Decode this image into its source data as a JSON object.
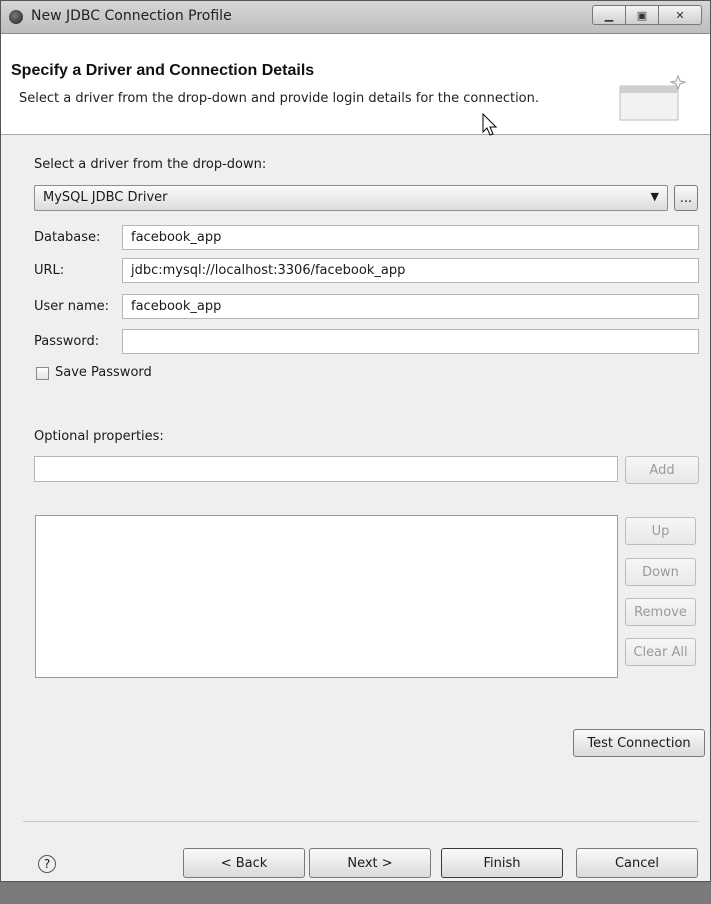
{
  "window": {
    "title": "New JDBC Connection Profile"
  },
  "banner": {
    "title": "Specify a Driver and Connection Details",
    "description": "Select a driver from the drop-down and provide login details for the connection."
  },
  "driver": {
    "label": "Select a driver from the drop-down:",
    "selected": "MySQL JDBC Driver",
    "browse_label": "..."
  },
  "fields": {
    "database": {
      "label": "Database:",
      "value": "facebook_app"
    },
    "url": {
      "label": "URL:",
      "value": "jdbc:mysql://localhost:3306/facebook_app"
    },
    "username": {
      "label": "User name:",
      "value": "facebook_app"
    },
    "password": {
      "label": "Password:",
      "value": ""
    }
  },
  "save_password": {
    "label": "Save Password",
    "checked": false
  },
  "optional": {
    "label": "Optional properties:",
    "add_label": "Add",
    "up_label": "Up",
    "down_label": "Down",
    "remove_label": "Remove",
    "clear_label": "Clear All"
  },
  "test_connection_label": "Test Connection",
  "footer": {
    "help_icon": "?",
    "back_label": "< Back",
    "next_label": "Next >",
    "finish_label": "Finish",
    "cancel_label": "Cancel"
  },
  "icons": {
    "window_icon": "eclipse-icon",
    "minimize": "minimize-icon",
    "maximize": "maximize-icon",
    "close": "close-icon",
    "help": "help-icon"
  }
}
